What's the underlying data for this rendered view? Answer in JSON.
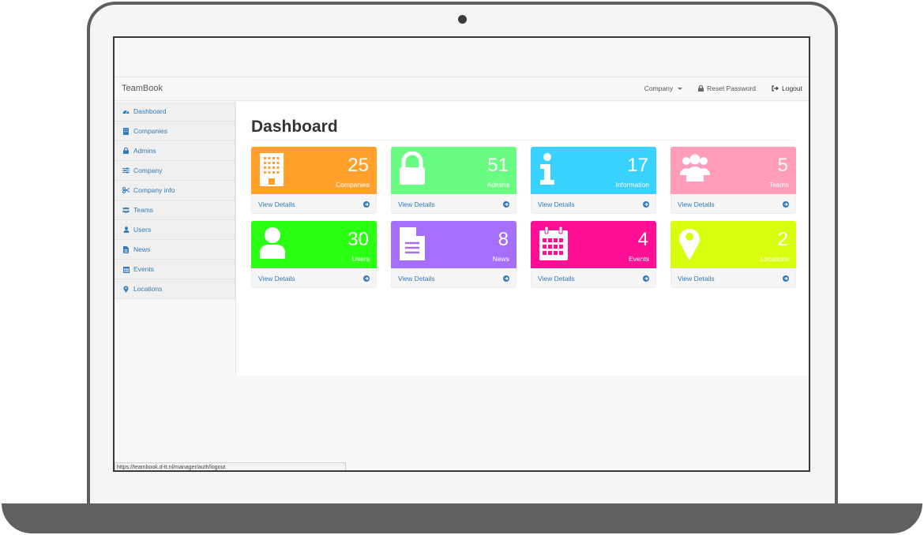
{
  "navbar": {
    "brand": "TeamBook",
    "company_menu": "Company",
    "reset_password": "Reset Password",
    "logout": "Logout"
  },
  "sidebar": {
    "items": [
      {
        "label": "Dashboard",
        "icon": "dashboard-icon"
      },
      {
        "label": "Companies",
        "icon": "building-icon"
      },
      {
        "label": "Admins",
        "icon": "lock-icon"
      },
      {
        "label": "Company",
        "icon": "sliders-icon"
      },
      {
        "label": "Company info",
        "icon": "scissors-icon"
      },
      {
        "label": "Teams",
        "icon": "users-icon"
      },
      {
        "label": "Users",
        "icon": "user-icon"
      },
      {
        "label": "News",
        "icon": "file-icon"
      },
      {
        "label": "Events",
        "icon": "calendar-icon"
      },
      {
        "label": "Locations",
        "icon": "map-marker-icon"
      }
    ]
  },
  "main": {
    "title": "Dashboard",
    "cards": [
      {
        "count": "25",
        "label": "Companies",
        "link": "View Details",
        "color": "#ffa12b",
        "icon": "building-icon"
      },
      {
        "count": "51",
        "label": "Admins",
        "link": "View Details",
        "color": "#6afb83",
        "icon": "lock-icon"
      },
      {
        "count": "17",
        "label": "Information",
        "link": "View Details",
        "color": "#39d2ff",
        "icon": "info-icon"
      },
      {
        "count": "5",
        "label": "Teams",
        "link": "View Details",
        "color": "#ff9dbb",
        "icon": "users-icon"
      },
      {
        "count": "30",
        "label": "Users",
        "link": "View Details",
        "color": "#2bff14",
        "icon": "user-icon"
      },
      {
        "count": "8",
        "label": "News",
        "link": "View Details",
        "color": "#a66ffb",
        "icon": "file-icon"
      },
      {
        "count": "4",
        "label": "Events",
        "link": "View Details",
        "color": "#ff0f95",
        "icon": "calendar-icon"
      },
      {
        "count": "2",
        "label": "Locations",
        "link": "View Details",
        "color": "#d8ff0f",
        "icon": "map-marker-icon"
      }
    ]
  },
  "statusbar": {
    "url": "https://teambook.d-tt.nl/manager/auth/logout"
  }
}
